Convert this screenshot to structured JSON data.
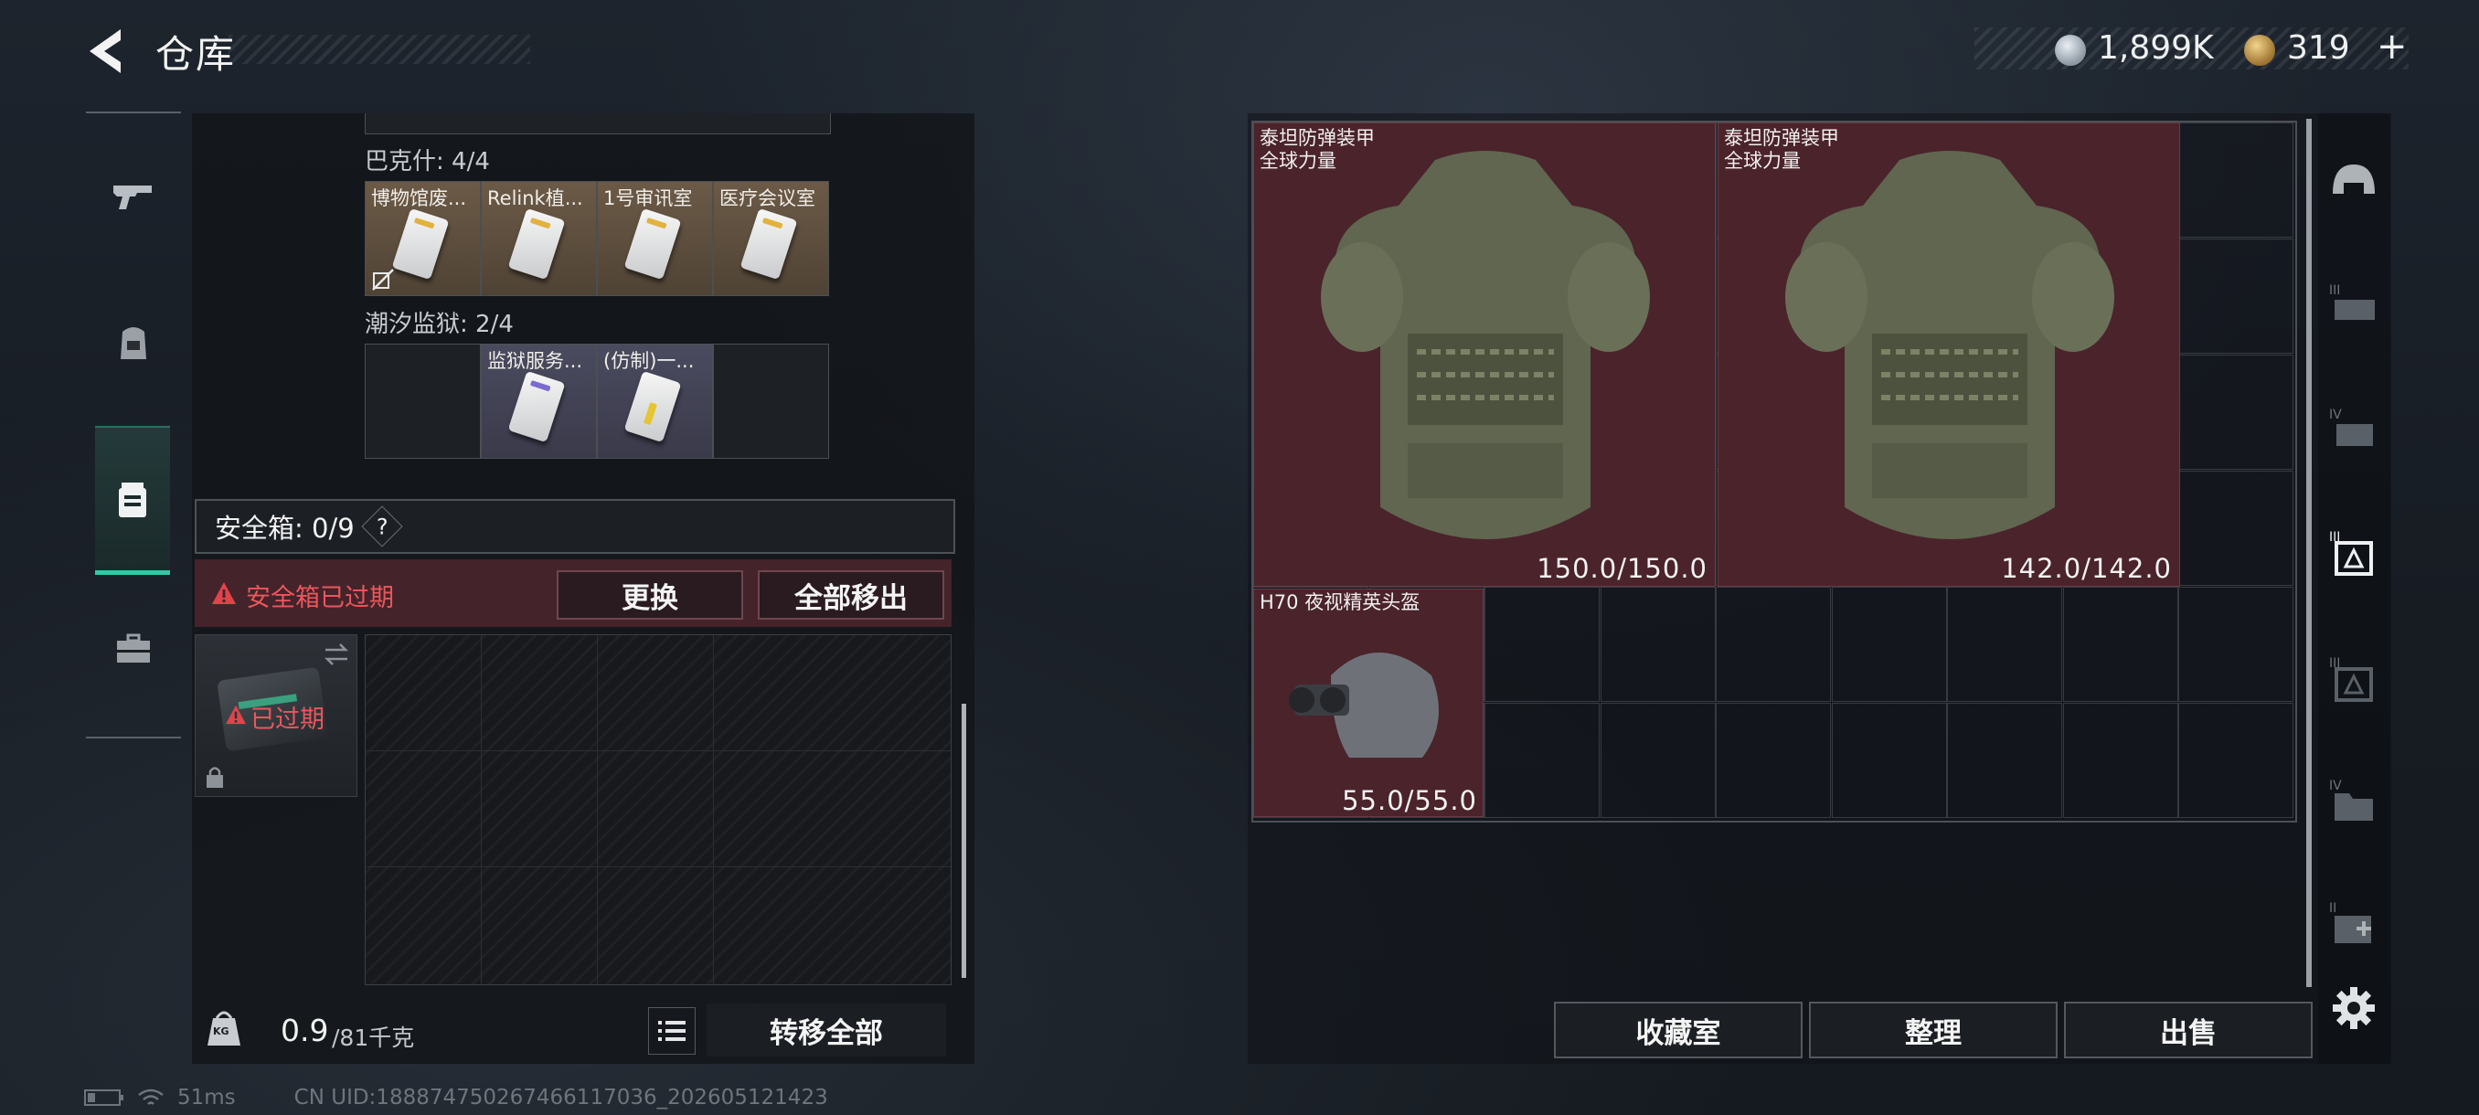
{
  "header": {
    "title": "仓库",
    "money": "1,899K",
    "gold": "319",
    "gold_plus": "+"
  },
  "left_nav": {
    "items": [
      {
        "icon": "gun-icon"
      },
      {
        "icon": "backpack-icon"
      },
      {
        "icon": "container-icon",
        "active": true
      },
      {
        "icon": "briefcase-icon"
      }
    ]
  },
  "key_groups": [
    {
      "label": "巴克什: 4/4",
      "items": [
        {
          "name": "博物馆废...",
          "rarity": "orange"
        },
        {
          "name": "Relink植...",
          "rarity": "orange"
        },
        {
          "name": "1号审讯室",
          "rarity": "orange"
        },
        {
          "name": "医疗会议室",
          "rarity": "orange"
        }
      ]
    },
    {
      "label": "潮汐监狱: 2/4",
      "items": [
        {
          "name": "",
          "rarity": "empty"
        },
        {
          "name": "监狱服务...",
          "rarity": "purple"
        },
        {
          "name": "(仿制)一...",
          "rarity": "purple"
        },
        {
          "name": "",
          "rarity": "empty"
        }
      ]
    }
  ],
  "safe_box": {
    "label": "安全箱: 0/9",
    "help": "?",
    "warning": "安全箱已过期",
    "replace_btn": "更换",
    "move_all_out_btn": "全部移出",
    "expired_label": "已过期"
  },
  "bottom_left": {
    "weight_icon_label": "KG",
    "weight_current": "0.9",
    "weight_max": "/81千克",
    "transfer_all_btn": "转移全部"
  },
  "inventory": [
    {
      "name_line1": "泰坦防弹装甲",
      "name_line2": "全球力量",
      "durability": "150.0/150.0"
    },
    {
      "name_line1": "泰坦防弹装甲",
      "name_line2": "全球力量",
      "durability": "142.0/142.0"
    },
    {
      "name_line1": "H70 夜视精英头盔",
      "name_line2": "",
      "durability": "55.0/55.0"
    }
  ],
  "right_rail": {
    "icons": [
      "helmet-icon",
      "rig-icon-iii",
      "rig-icon-iv",
      "chest-armor-icon-active",
      "chest-armor-icon-iii",
      "folder-icon-iv",
      "medkit-icon-ii"
    ]
  },
  "actions": {
    "collection_btn": "收藏室",
    "sort_btn": "整理",
    "sell_btn": "出售"
  },
  "status_bar": {
    "ping": "51ms",
    "uid": "CN UID:1888747502674661170­36_202605121423"
  },
  "colors": {
    "accent_teal": "#33c9a6",
    "warning_red": "#e0444a",
    "item_red_bg": "#4b232b",
    "item_orange_bg": "#6c5a47",
    "item_purple_bg": "#4a4b5f"
  }
}
